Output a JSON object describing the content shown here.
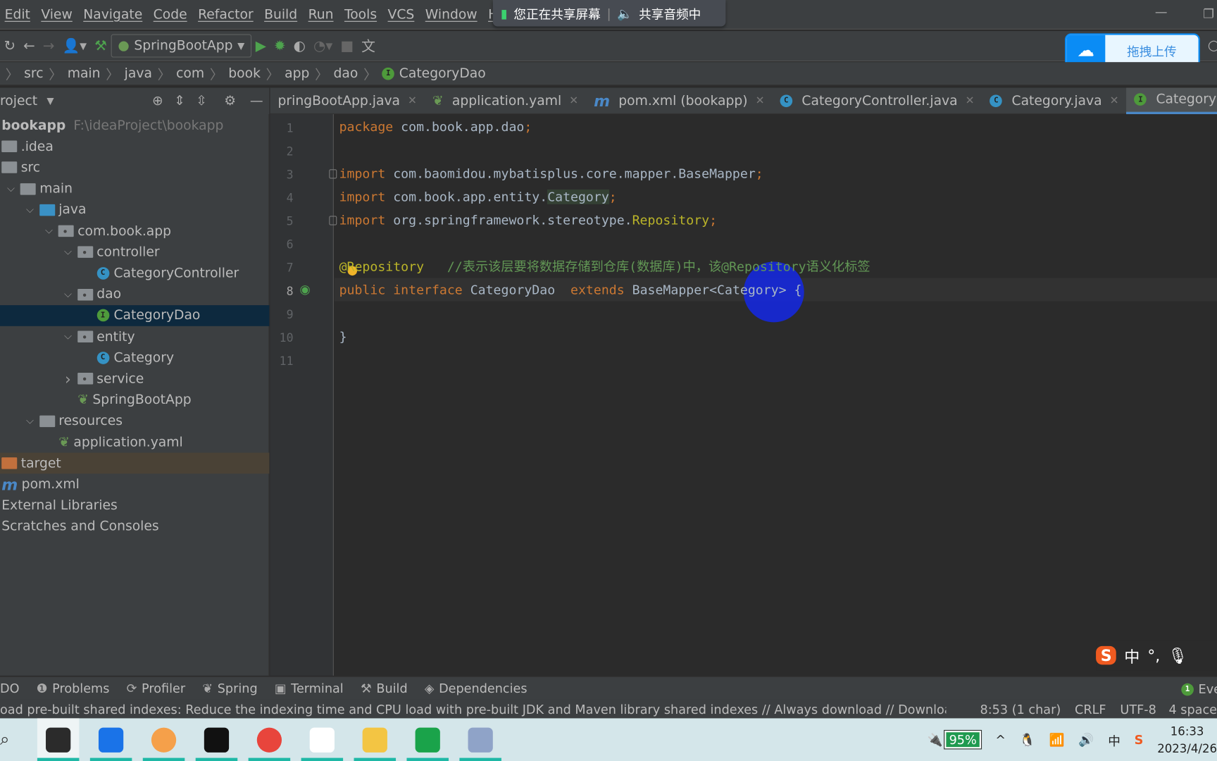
{
  "menu": [
    "Edit",
    "View",
    "Navigate",
    "Code",
    "Refactor",
    "Build",
    "Run",
    "Tools",
    "VCS",
    "Window",
    "H"
  ],
  "share_banner": {
    "screen": "您正在共享屏幕",
    "audio": "共享音频中"
  },
  "toolbar": {
    "run_config": "SpringBootApp",
    "icons": [
      "sync-icon",
      "back-icon",
      "forward-icon",
      "user-icon",
      "build-hammer-icon",
      "run-icon",
      "debug-icon",
      "coverage-icon",
      "profile-icon",
      "stop-icon",
      "translate-icon"
    ]
  },
  "baidu": {
    "label": "拖拽上传"
  },
  "breadcrumb": [
    "src",
    "main",
    "java",
    "com",
    "book",
    "app",
    "dao",
    "CategoryDao"
  ],
  "project_panel": {
    "title": "roject"
  },
  "tabs": [
    {
      "label": "pringBootApp.java",
      "icon": "spring",
      "active": false
    },
    {
      "label": "application.yaml",
      "icon": "spring",
      "active": false
    },
    {
      "label": "pom.xml (bookapp)",
      "icon": "maven",
      "active": false
    },
    {
      "label": "CategoryController.java",
      "icon": "class",
      "active": false
    },
    {
      "label": "Category.java",
      "icon": "class",
      "active": false
    },
    {
      "label": "CategoryDao.java",
      "icon": "interface",
      "active": true
    }
  ],
  "tree": [
    {
      "label": "bookapp",
      "path": "F:\\ideaProject\\bookapp",
      "depth": 0,
      "kind": "root"
    },
    {
      "label": ".idea",
      "depth": 0,
      "kind": "folder"
    },
    {
      "label": "src",
      "depth": 0,
      "kind": "folder"
    },
    {
      "label": "main",
      "depth": 0,
      "kind": "folder",
      "arrow": "open"
    },
    {
      "label": "java",
      "depth": 1,
      "kind": "blue",
      "arrow": "open"
    },
    {
      "label": "com.book.app",
      "depth": 2,
      "kind": "pkg",
      "arrow": "open"
    },
    {
      "label": "controller",
      "depth": 3,
      "kind": "pkg",
      "arrow": "open"
    },
    {
      "label": "CategoryController",
      "depth": 5,
      "kind": "class"
    },
    {
      "label": "dao",
      "depth": 3,
      "kind": "pkg",
      "arrow": "open"
    },
    {
      "label": "CategoryDao",
      "depth": 5,
      "kind": "interface",
      "selected": true
    },
    {
      "label": "entity",
      "depth": 3,
      "kind": "pkg",
      "arrow": "open"
    },
    {
      "label": "Category",
      "depth": 5,
      "kind": "class"
    },
    {
      "label": "service",
      "depth": 3,
      "kind": "pkg",
      "arrow": "closed"
    },
    {
      "label": "SpringBootApp",
      "depth": 4,
      "kind": "spring"
    },
    {
      "label": "resources",
      "depth": 1,
      "kind": "folder",
      "arrow": "open"
    },
    {
      "label": "application.yaml",
      "depth": 3,
      "kind": "spring"
    },
    {
      "label": "target",
      "depth": 0,
      "kind": "orange",
      "highlight": true
    },
    {
      "label": "pom.xml",
      "depth": 0,
      "kind": "maven"
    },
    {
      "label": "External Libraries",
      "depth": 0,
      "kind": "none"
    },
    {
      "label": "Scratches and Consoles",
      "depth": 0,
      "kind": "none"
    }
  ],
  "code": [
    [
      [
        "k",
        "package "
      ],
      [
        "p",
        "com.book.app.dao"
      ],
      [
        "k",
        ";"
      ]
    ],
    [],
    [
      [
        "k",
        "import "
      ],
      [
        "p",
        "com.baomidou.mybatisplus.core.mapper.BaseMapper"
      ],
      [
        "k",
        ";"
      ]
    ],
    [
      [
        "k",
        "import "
      ],
      [
        "p",
        "com.book.app.entity."
      ],
      [
        "hl",
        "Category"
      ],
      [
        "k",
        ";"
      ]
    ],
    [
      [
        "k",
        "import "
      ],
      [
        "p",
        "org.springframework.stereotype."
      ],
      [
        "an",
        "Repository"
      ],
      [
        "k",
        ";"
      ]
    ],
    [],
    [
      [
        "an",
        "@Repository"
      ],
      [
        "p",
        "   "
      ],
      [
        "cm",
        "//表示该层要将数据存储到仓库(数据库)中，该@Repository语义化标签"
      ]
    ],
    [
      [
        "k",
        "public interface "
      ],
      [
        "p",
        "CategoryDao  "
      ],
      [
        "k",
        "extends "
      ],
      [
        "p",
        "BaseMapper<Category> {"
      ]
    ],
    [],
    [
      [
        "p",
        "}"
      ]
    ],
    []
  ],
  "current_line": 8,
  "tool_windows": [
    "DO",
    "Problems",
    "Profiler",
    "Spring",
    "Terminal",
    "Build",
    "Dependencies"
  ],
  "event_log": {
    "count": "1",
    "label": "Eve"
  },
  "status": {
    "message": "oad pre-built shared indexes: Reduce the indexing time and CPU load with pre-built JDK and Maven library shared indexes // Always download // Download c",
    "position": "8:53 (1 char)",
    "line_sep": "CRLF",
    "encoding": "UTF-8",
    "indent": "4 space"
  },
  "ime": {
    "mode": "中",
    "punct": "°,"
  },
  "taskbar": {
    "apps": [
      "intellij-idea",
      "feishu",
      "briefcase",
      "terminal",
      "chrome",
      "baidu-netdisk",
      "file-explorer",
      "hbuilder",
      "dolphin"
    ],
    "battery": "95%",
    "time": "16:33",
    "date": "2023/4/26"
  }
}
